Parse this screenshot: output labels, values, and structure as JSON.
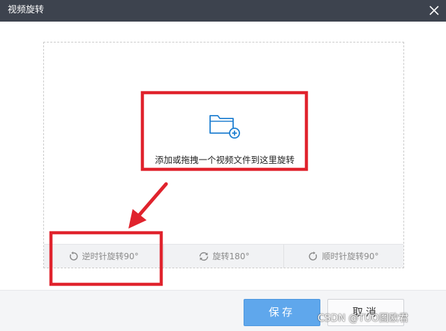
{
  "window": {
    "title": "视频旋转",
    "close_icon": "close-icon"
  },
  "drop_area": {
    "hint": "添加或拖拽一个视频文件到这里旋转",
    "icon": "folder-add-icon",
    "accent": "#1e7fd1"
  },
  "rotate_bar": {
    "counterclockwise_label": "逆时针旋转90°",
    "rotate180_label": "旋转180°",
    "clockwise_label": "顺时针旋转90°"
  },
  "footer": {
    "save_label": "保存",
    "cancel_label": "取消"
  },
  "annotation": {
    "highlight_color": "#e0232d"
  },
  "watermark": "CSDN @TUO图欧君"
}
